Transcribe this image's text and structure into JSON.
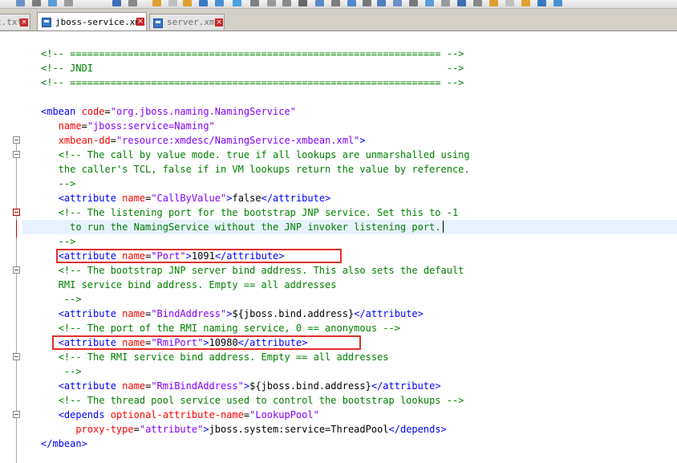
{
  "tabs": [
    {
      "label": "c.txt",
      "active": false
    },
    {
      "label": "jboss-service.xml",
      "active": true
    },
    {
      "label": "server.xml",
      "active": false
    }
  ],
  "colors": {
    "comment": "#008000",
    "tag": "#0000ff",
    "attr_name": "#ff0000",
    "attr_value": "#8000ff",
    "highlight_box": "#e0302b"
  },
  "lines": [
    {
      "segs": [
        {
          "k": "c",
          "t": "<!-- ================================================================ -->"
        }
      ]
    },
    {
      "segs": [
        {
          "k": "c",
          "t": "<!-- JNDI                                                             -->"
        }
      ]
    },
    {
      "segs": [
        {
          "k": "c",
          "t": "<!-- ================================================================ -->"
        }
      ]
    },
    {
      "segs": [
        {
          "k": "p",
          "t": ""
        }
      ]
    },
    {
      "segs": [
        {
          "k": "t",
          "t": "<mbean"
        },
        {
          "k": "p",
          "t": " "
        },
        {
          "k": "a",
          "t": "code"
        },
        {
          "k": "p",
          "t": "="
        },
        {
          "k": "v",
          "t": "\"org.jboss.naming.NamingService\""
        }
      ]
    },
    {
      "segs": [
        {
          "k": "p",
          "t": "   "
        },
        {
          "k": "a",
          "t": "name"
        },
        {
          "k": "p",
          "t": "="
        },
        {
          "k": "v",
          "t": "\"jboss:service=Naming\""
        }
      ]
    },
    {
      "segs": [
        {
          "k": "p",
          "t": "   "
        },
        {
          "k": "a",
          "t": "xmbean-dd"
        },
        {
          "k": "p",
          "t": "="
        },
        {
          "k": "v",
          "t": "\"resource:xmdesc/NamingService-xmbean.xml\""
        },
        {
          "k": "t",
          "t": ">"
        }
      ]
    },
    {
      "segs": [
        {
          "k": "p",
          "t": "   "
        },
        {
          "k": "c",
          "t": "<!-- The call by value mode. true if all lookups are unmarshalled using"
        }
      ]
    },
    {
      "segs": [
        {
          "k": "c",
          "t": "   the caller's TCL, false if in VM lookups return the value by reference."
        }
      ]
    },
    {
      "segs": [
        {
          "k": "c",
          "t": "   -->"
        }
      ]
    },
    {
      "segs": [
        {
          "k": "p",
          "t": "   "
        },
        {
          "k": "t",
          "t": "<attribute"
        },
        {
          "k": "p",
          "t": " "
        },
        {
          "k": "a",
          "t": "name"
        },
        {
          "k": "p",
          "t": "="
        },
        {
          "k": "v",
          "t": "\"CallByValue\""
        },
        {
          "k": "t",
          "t": ">"
        },
        {
          "k": "p",
          "t": "false"
        },
        {
          "k": "t",
          "t": "</attribute>"
        }
      ]
    },
    {
      "segs": [
        {
          "k": "p",
          "t": "   "
        },
        {
          "k": "c",
          "t": "<!-- The listening port for the bootstrap JNP service. Set this to -1"
        }
      ]
    },
    {
      "segs": [
        {
          "k": "c",
          "t": "     to run the NamingService without the JNP invoker listening port."
        }
      ]
    },
    {
      "segs": [
        {
          "k": "c",
          "t": "   -->"
        }
      ]
    },
    {
      "segs": [
        {
          "k": "p",
          "t": "   "
        },
        {
          "k": "t",
          "t": "<attribute"
        },
        {
          "k": "p",
          "t": " "
        },
        {
          "k": "a",
          "t": "name"
        },
        {
          "k": "p",
          "t": "="
        },
        {
          "k": "v",
          "t": "\"Port\""
        },
        {
          "k": "t",
          "t": ">"
        },
        {
          "k": "p",
          "t": "1091"
        },
        {
          "k": "t",
          "t": "</attribute>"
        }
      ]
    },
    {
      "segs": [
        {
          "k": "p",
          "t": "   "
        },
        {
          "k": "c",
          "t": "<!-- The bootstrap JNP server bind address. This also sets the default"
        }
      ]
    },
    {
      "segs": [
        {
          "k": "c",
          "t": "   RMI service bind address. Empty == all addresses"
        }
      ]
    },
    {
      "segs": [
        {
          "k": "c",
          "t": "    -->"
        }
      ]
    },
    {
      "segs": [
        {
          "k": "p",
          "t": "   "
        },
        {
          "k": "t",
          "t": "<attribute"
        },
        {
          "k": "p",
          "t": " "
        },
        {
          "k": "a",
          "t": "name"
        },
        {
          "k": "p",
          "t": "="
        },
        {
          "k": "v",
          "t": "\"BindAddress\""
        },
        {
          "k": "t",
          "t": ">"
        },
        {
          "k": "p",
          "t": "${jboss.bind.address}"
        },
        {
          "k": "t",
          "t": "</attribute>"
        }
      ]
    },
    {
      "segs": [
        {
          "k": "p",
          "t": "   "
        },
        {
          "k": "c",
          "t": "<!-- The port of the RMI naming service, 0 == anonymous -->"
        }
      ]
    },
    {
      "segs": [
        {
          "k": "p",
          "t": "   "
        },
        {
          "k": "t",
          "t": "<attribute"
        },
        {
          "k": "p",
          "t": " "
        },
        {
          "k": "a",
          "t": "name"
        },
        {
          "k": "p",
          "t": "="
        },
        {
          "k": "v",
          "t": "\"RmiPort\""
        },
        {
          "k": "t",
          "t": ">"
        },
        {
          "k": "p",
          "t": "10980"
        },
        {
          "k": "t",
          "t": "</attribute>"
        }
      ]
    },
    {
      "segs": [
        {
          "k": "p",
          "t": "   "
        },
        {
          "k": "c",
          "t": "<!-- The RMI service bind address. Empty == all addresses"
        }
      ]
    },
    {
      "segs": [
        {
          "k": "c",
          "t": "    -->"
        }
      ]
    },
    {
      "segs": [
        {
          "k": "p",
          "t": "   "
        },
        {
          "k": "t",
          "t": "<attribute"
        },
        {
          "k": "p",
          "t": " "
        },
        {
          "k": "a",
          "t": "name"
        },
        {
          "k": "p",
          "t": "="
        },
        {
          "k": "v",
          "t": "\"RmiBindAddress\""
        },
        {
          "k": "t",
          "t": ">"
        },
        {
          "k": "p",
          "t": "${jboss.bind.address}"
        },
        {
          "k": "t",
          "t": "</attribute>"
        }
      ]
    },
    {
      "segs": [
        {
          "k": "p",
          "t": "   "
        },
        {
          "k": "c",
          "t": "<!-- The thread pool service used to control the bootstrap lookups -->"
        }
      ]
    },
    {
      "segs": [
        {
          "k": "p",
          "t": "   "
        },
        {
          "k": "t",
          "t": "<depends"
        },
        {
          "k": "p",
          "t": " "
        },
        {
          "k": "a",
          "t": "optional-attribute-name"
        },
        {
          "k": "p",
          "t": "="
        },
        {
          "k": "v",
          "t": "\"LookupPool\""
        }
      ]
    },
    {
      "segs": [
        {
          "k": "p",
          "t": "      "
        },
        {
          "k": "a",
          "t": "proxy-type"
        },
        {
          "k": "p",
          "t": "="
        },
        {
          "k": "v",
          "t": "\"attribute\""
        },
        {
          "k": "t",
          "t": ">"
        },
        {
          "k": "p",
          "t": "jboss.system:service=ThreadPool"
        },
        {
          "k": "t",
          "t": "</depends>"
        }
      ]
    },
    {
      "segs": [
        {
          "k": "t",
          "t": "</mbean>"
        }
      ]
    }
  ]
}
